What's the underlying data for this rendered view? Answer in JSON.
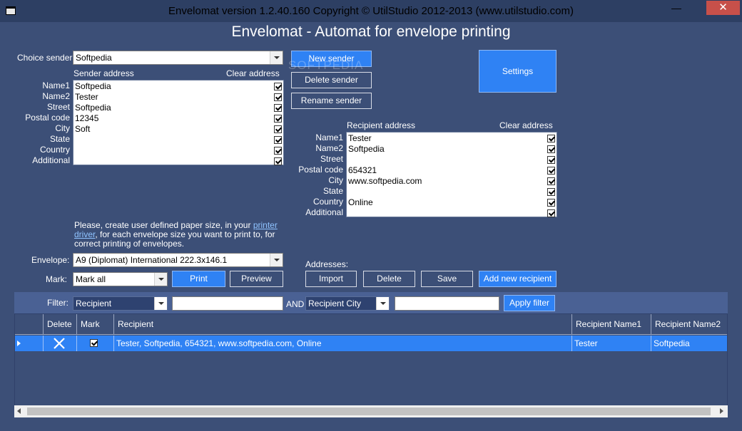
{
  "window": {
    "title": "Envelomat version 1.2.40.160 Copyright © UtilStudio 2012-2013 (www.utilstudio.com)",
    "minimize": "—",
    "close": "✕"
  },
  "heading": "Envelomat - Automat for envelope printing",
  "watermark": "SOFTPEDIA",
  "sender": {
    "choice_label": "Choice sender:",
    "choice_value": "Softpedia",
    "address_label": "Sender address",
    "clear_label": "Clear address",
    "fields": [
      {
        "label": "Name1",
        "value": "Softpedia"
      },
      {
        "label": "Name2",
        "value": "Tester"
      },
      {
        "label": "Street",
        "value": "Softpedia"
      },
      {
        "label": "Postal code",
        "value": "12345"
      },
      {
        "label": "City",
        "value": "Soft"
      },
      {
        "label": "State",
        "value": ""
      },
      {
        "label": "Country",
        "value": ""
      },
      {
        "label": "Additional",
        "value": ""
      }
    ],
    "buttons": {
      "new": "New sender",
      "delete": "Delete sender",
      "rename": "Rename sender"
    }
  },
  "settings_button": "Settings",
  "recipient": {
    "address_label": "Recipient address",
    "clear_label": "Clear address",
    "fields": [
      {
        "label": "Name1",
        "value": "Tester"
      },
      {
        "label": "Name2",
        "value": "Softpedia"
      },
      {
        "label": "Street",
        "value": ""
      },
      {
        "label": "Postal code",
        "value": "654321"
      },
      {
        "label": "City",
        "value": "www.softpedia.com"
      },
      {
        "label": "State",
        "value": ""
      },
      {
        "label": "Country",
        "value": "Online"
      },
      {
        "label": "Additional",
        "value": ""
      }
    ]
  },
  "info": {
    "line1_pre": "Please, create user defined paper size, in your ",
    "link1": "printer",
    "link2": "driver",
    "line2_post": ", for each envelope size you want to print to, for",
    "line3": "correct printing of envelopes."
  },
  "envelope": {
    "label": "Envelope:",
    "value": "A9 (Diplomat) International 222.3x146.1"
  },
  "mark": {
    "label": "Mark:",
    "value": "Mark all",
    "print": "Print",
    "preview": "Preview"
  },
  "addresses": {
    "label": "Addresses:",
    "import": "Import",
    "delete": "Delete",
    "save": "Save",
    "add": "Add new recipient"
  },
  "filter": {
    "label": "Filter:",
    "field1": "Recipient",
    "and": "AND",
    "field2": "Recipient City",
    "apply": "Apply filter"
  },
  "grid": {
    "headers": {
      "delete": "Delete",
      "mark": "Mark",
      "recipient": "Recipient",
      "name1": "Recipient Name1",
      "name2": "Recipient Name2"
    },
    "rows": [
      {
        "recipient": "Tester, Softpedia, 654321, www.softpedia.com, Online",
        "name1": "Tester",
        "name2": "Softpedia"
      }
    ]
  }
}
